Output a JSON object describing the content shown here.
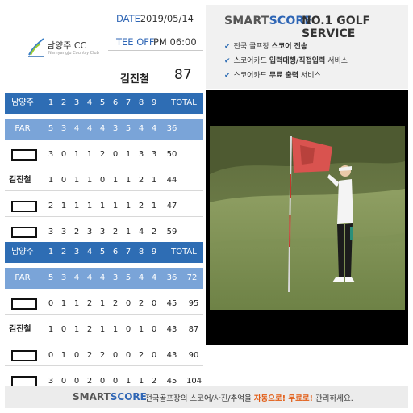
{
  "round": {
    "club_name": "남양주 CC",
    "club_sub": "Namyangju Country Club",
    "date_label": "DATE",
    "date_value": "2019/05/14",
    "tee_label": "TEE OFF",
    "tee_value": "PM 06:00",
    "player_name": "김진철",
    "player_total": "87"
  },
  "front": {
    "header": [
      "남양주",
      "1",
      "2",
      "3",
      "4",
      "5",
      "6",
      "7",
      "8",
      "9",
      "TOTAL"
    ],
    "par": [
      "PAR",
      "5",
      "3",
      "4",
      "4",
      "4",
      "3",
      "5",
      "4",
      "4",
      "36"
    ],
    "players": [
      {
        "name": "",
        "redacted": true,
        "scores": [
          "3",
          "0",
          "1",
          "1",
          "2",
          "0",
          "1",
          "3",
          "3",
          "50"
        ]
      },
      {
        "name": "김진철",
        "redacted": false,
        "scores": [
          "1",
          "0",
          "1",
          "1",
          "0",
          "1",
          "1",
          "2",
          "1",
          "44"
        ]
      },
      {
        "name": "",
        "redacted": true,
        "scores": [
          "2",
          "1",
          "1",
          "1",
          "1",
          "1",
          "1",
          "2",
          "1",
          "47"
        ]
      },
      {
        "name": "",
        "redacted": true,
        "scores": [
          "3",
          "3",
          "2",
          "3",
          "3",
          "2",
          "1",
          "4",
          "2",
          "59"
        ]
      }
    ]
  },
  "back": {
    "header": [
      "남양주",
      "1",
      "2",
      "3",
      "4",
      "5",
      "6",
      "7",
      "8",
      "9",
      "TOTAL"
    ],
    "par": [
      "PAR",
      "5",
      "3",
      "4",
      "4",
      "4",
      "3",
      "5",
      "4",
      "4",
      "36",
      "72"
    ],
    "players": [
      {
        "name": "",
        "redacted": true,
        "scores": [
          "0",
          "1",
          "1",
          "2",
          "1",
          "2",
          "0",
          "2",
          "0",
          "45",
          "95"
        ]
      },
      {
        "name": "김진철",
        "redacted": false,
        "scores": [
          "1",
          "0",
          "1",
          "2",
          "1",
          "1",
          "0",
          "1",
          "0",
          "43",
          "87"
        ]
      },
      {
        "name": "",
        "redacted": true,
        "scores": [
          "0",
          "1",
          "0",
          "2",
          "2",
          "0",
          "0",
          "2",
          "0",
          "43",
          "90"
        ]
      },
      {
        "name": "",
        "redacted": true,
        "scores": [
          "3",
          "0",
          "0",
          "2",
          "0",
          "0",
          "1",
          "1",
          "2",
          "45",
          "104"
        ]
      }
    ]
  },
  "promo": {
    "logo_a": "SMART",
    "logo_b": "SCORE",
    "tagline": "NO.1 GOLF SERVICE",
    "lines": [
      {
        "pre": "전국 골프장 ",
        "emph": "스코어 전송",
        "post": ""
      },
      {
        "pre": "스코어카드 ",
        "emph": "입력대행/직접입력",
        "post": " 서비스"
      },
      {
        "pre": "스코어카드 ",
        "emph": "무료 출력",
        "post": " 서비스"
      }
    ]
  },
  "footer": {
    "logo_a": "SMART",
    "logo_b": "SCORE",
    "text_pre": "전국골프장의 스코어/사진/추억을 ",
    "text_hl": "자동으로! 무료로!",
    "text_post": " 관리하세요."
  },
  "colors": {
    "header_blue": "#2e6db4",
    "par_blue": "#7aa4d8",
    "accent_orange": "#e25a12"
  }
}
